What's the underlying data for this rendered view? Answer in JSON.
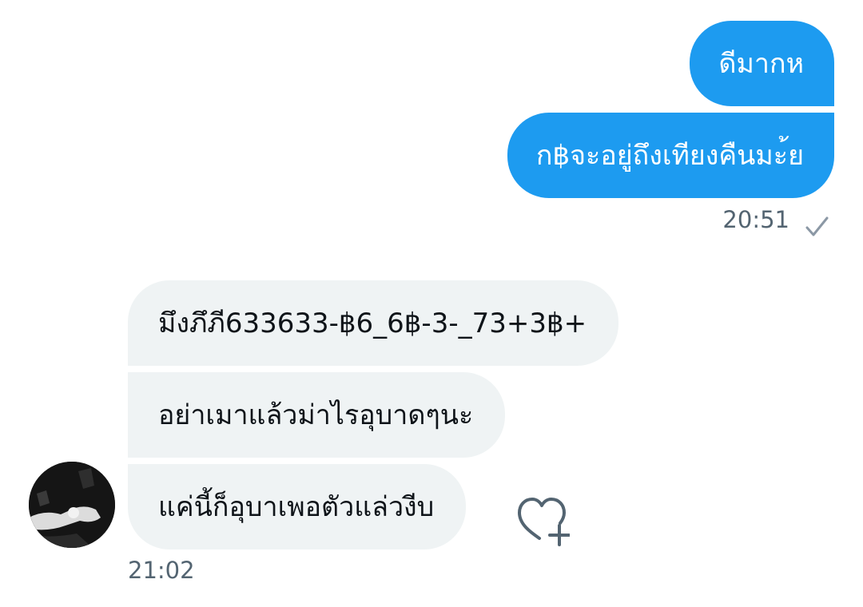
{
  "theme": {
    "accent": "#1d9bf0",
    "incoming_bubble": "#eff3f4",
    "meta_text": "#536471"
  },
  "conversation": {
    "outgoing": {
      "messages": [
        "ดีมากห",
        "ก฿จะอยู่ถึงเทียงคืนมะ้ย"
      ],
      "time": "20:51",
      "status_icon": "check-icon"
    },
    "incoming": {
      "messages": [
        "มึงภึภี633633-฿6_6฿-3-_73+3฿+",
        "อย่าเมาแล้วม่าไรอุบาดๆนะ",
        "แค่นี้ก็อุบาเพอตัวแล่วงีบ"
      ],
      "time": "21:02",
      "avatar_icon": "avatar-photo",
      "reaction_icon": "heart-plus-icon"
    }
  }
}
